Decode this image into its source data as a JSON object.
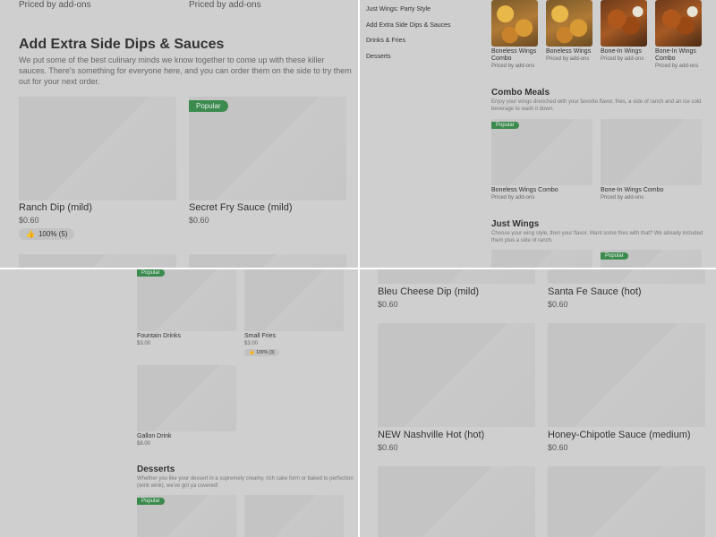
{
  "q1": {
    "top_price_left": "Priced by add-ons",
    "top_price_right": "Priced by add-ons",
    "section_title": "Add Extra Side Dips & Sauces",
    "section_desc_1": "We put some of the best culinary minds we know together to come up with these killer",
    "section_desc_2": "sauces. There's something for everyone here, and you can order them on the side to try them",
    "section_desc_3": "out for your next order.",
    "item1_name": "Ranch Dip (mild)",
    "item1_price": "$0.60",
    "item1_rating": "100% (5)",
    "item2_badge": "Popular",
    "item2_name": "Secret Fry Sauce (mild)",
    "item2_price": "$0.60"
  },
  "q2": {
    "nav": [
      "Just Wings: Party Style",
      "Add Extra Side Dips & Sauces",
      "Drinks & Fries",
      "Desserts"
    ],
    "top_items": [
      {
        "name_1": "Boneless Wings",
        "name_2": "Combo",
        "price": "Priced by add-ons"
      },
      {
        "name_1": "Boneless Wings",
        "name_2": "",
        "price": "Priced by add-ons"
      },
      {
        "name_1": "Bone-In Wings",
        "name_2": "",
        "price": "Priced by add-ons"
      },
      {
        "name_1": "Bone-In Wings",
        "name_2": "Combo",
        "price": "Priced by add-ons"
      }
    ],
    "combo_title": "Combo Meals",
    "combo_desc_1": "Enjoy your wings drenched with your favorite flavor, fries, a side of ranch and an ice cold",
    "combo_desc_2": "beverage to wash it down.",
    "combo_badge": "Popular",
    "combo_items": [
      {
        "name": "Boneless Wings Combo",
        "price": "Priced by add-ons"
      },
      {
        "name": "Bone-In Wings Combo",
        "price": "Priced by add-ons"
      }
    ],
    "just_title": "Just Wings",
    "just_desc_1": "Choose your wing style, then your flavor. Want some fries with that? We already included",
    "just_desc_2": "them plus a side of ranch.",
    "just_badge": "Popular"
  },
  "q3": {
    "badge_top": "Popular",
    "items": [
      {
        "name": "Fountain Drinks",
        "price": "$3.00"
      },
      {
        "name": "Small Fries",
        "price": "$3.00",
        "rating": "100% (3)"
      },
      {
        "name": "Gallon Drink",
        "price": "$8.00"
      }
    ],
    "desserts_title": "Desserts",
    "desserts_desc_1": "Whether you like your dessert in a supremely creamy, rich cake form or baked to perfection",
    "desserts_desc_2": "(wink wink), we've got ya covered!",
    "desserts_badge": "Popular"
  },
  "q4": {
    "items": [
      {
        "name": "Bleu Cheese Dip (mild)",
        "price": "$0.60"
      },
      {
        "name": "Santa Fe Sauce (hot)",
        "price": "$0.60"
      },
      {
        "name": "NEW Nashville Hot (hot)",
        "price": "$0.60"
      },
      {
        "name": "Honey-Chipotle Sauce (medium)",
        "price": "$0.60"
      }
    ]
  }
}
